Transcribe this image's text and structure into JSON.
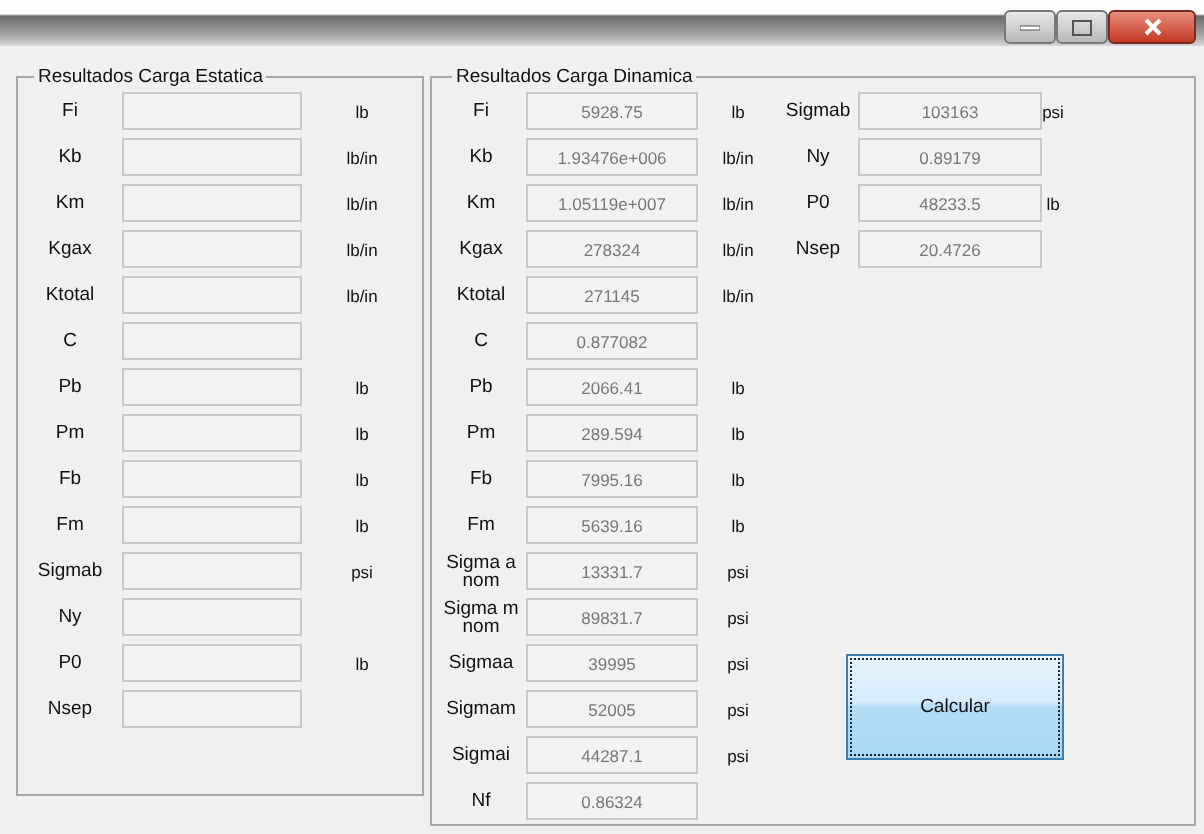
{
  "static_panel": {
    "title": "Resultados Carga Estatica",
    "rows": [
      {
        "label": "Fi",
        "unit": "lb"
      },
      {
        "label": "Kb",
        "unit": "lb/in"
      },
      {
        "label": "Km",
        "unit": "lb/in"
      },
      {
        "label": "Kgax",
        "unit": "lb/in"
      },
      {
        "label": "Ktotal",
        "unit": "lb/in"
      },
      {
        "label": "C"
      },
      {
        "label": "Pb",
        "unit": "lb"
      },
      {
        "label": "Pm",
        "unit": "lb"
      },
      {
        "label": "Fb",
        "unit": "lb"
      },
      {
        "label": "Fm",
        "unit": "lb"
      },
      {
        "label": "Sigmab",
        "unit": "psi"
      },
      {
        "label": "Ny"
      },
      {
        "label": "P0",
        "unit": "lb"
      },
      {
        "label": "Nsep"
      }
    ]
  },
  "dynamic_panel": {
    "title": "Resultados Carga Dinamica",
    "rows": [
      {
        "label": "Fi",
        "value": "5928.75",
        "unit": "lb"
      },
      {
        "label": "Kb",
        "value": "1.93476e+006",
        "unit": "lb/in"
      },
      {
        "label": "Km",
        "value": "1.05119e+007",
        "unit": "lb/in"
      },
      {
        "label": "Kgax",
        "value": "278324",
        "unit": "lb/in"
      },
      {
        "label": "Ktotal",
        "value": "271145",
        "unit": "lb/in"
      },
      {
        "label": "C",
        "value": "0.877082"
      },
      {
        "label": "Pb",
        "value": "2066.41",
        "unit": "lb"
      },
      {
        "label": "Pm",
        "value": "289.594",
        "unit": "lb"
      },
      {
        "label": "Fb",
        "value": "7995.16",
        "unit": "lb"
      },
      {
        "label": "Fm",
        "value": "5639.16",
        "unit": "lb"
      },
      {
        "label": "Sigma a nom",
        "value": "13331.7",
        "unit": "psi"
      },
      {
        "label": "Sigma m nom",
        "value": "89831.7",
        "unit": "psi"
      },
      {
        "label": "Sigmaa",
        "value": "39995",
        "unit": "psi"
      },
      {
        "label": "Sigmam",
        "value": "52005",
        "unit": "psi"
      },
      {
        "label": "Sigmai",
        "value": "44287.1",
        "unit": "psi"
      },
      {
        "label": "Nf",
        "value": "0.86324"
      }
    ],
    "extra_rows": [
      {
        "label": "Sigmab",
        "value": "103163",
        "unit": "psi"
      },
      {
        "label": "Ny",
        "value": "0.89179"
      },
      {
        "label": "P0",
        "value": "48233.5",
        "unit": "lb"
      },
      {
        "label": "Nsep",
        "value": "20.4726"
      }
    ]
  },
  "buttons": [
    {
      "label": "Calcular",
      "focused": true
    }
  ]
}
